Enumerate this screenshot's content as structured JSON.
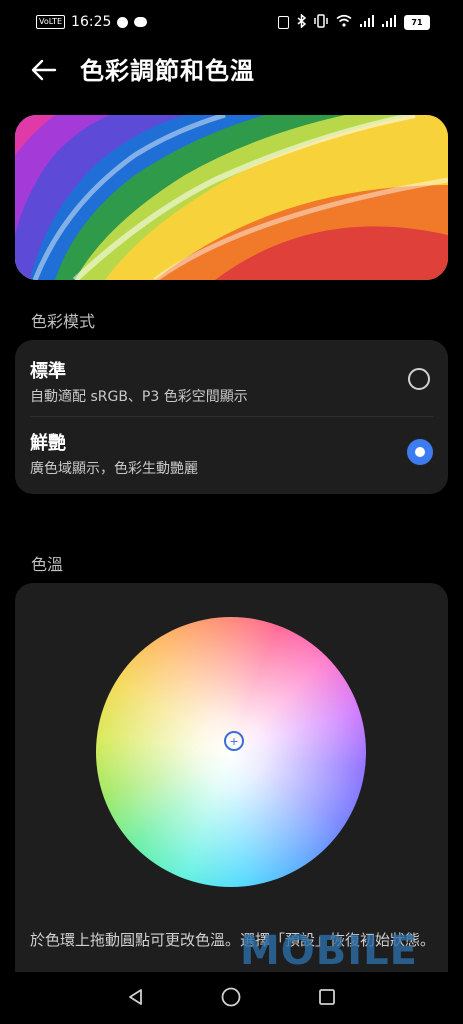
{
  "status_bar": {
    "volte": "VoLTE",
    "time": "16:25",
    "battery": "71"
  },
  "header": {
    "title": "色彩調節和色溫"
  },
  "color_mode": {
    "section_title": "色彩模式",
    "options": [
      {
        "title": "標準",
        "subtitle": "自動適配 sRGB、P3 色彩空間顯示",
        "selected": false
      },
      {
        "title": "鮮艷",
        "subtitle": "廣色域顯示，色彩生動艷麗",
        "selected": true
      }
    ]
  },
  "color_temperature": {
    "section_title": "色溫",
    "hint": "於色環上拖動圓點可更改色溫。選擇「預設」恢復初始狀態。"
  },
  "watermark": "MOBILE",
  "colors": {
    "accent": "#3d7cf0",
    "card_bg": "#1e1e1e",
    "background": "#000000"
  },
  "icons": {
    "back": "arrow-left-icon",
    "nav_back": "triangle-back-icon",
    "nav_home": "circle-home-icon",
    "nav_recent": "square-recent-icon"
  }
}
